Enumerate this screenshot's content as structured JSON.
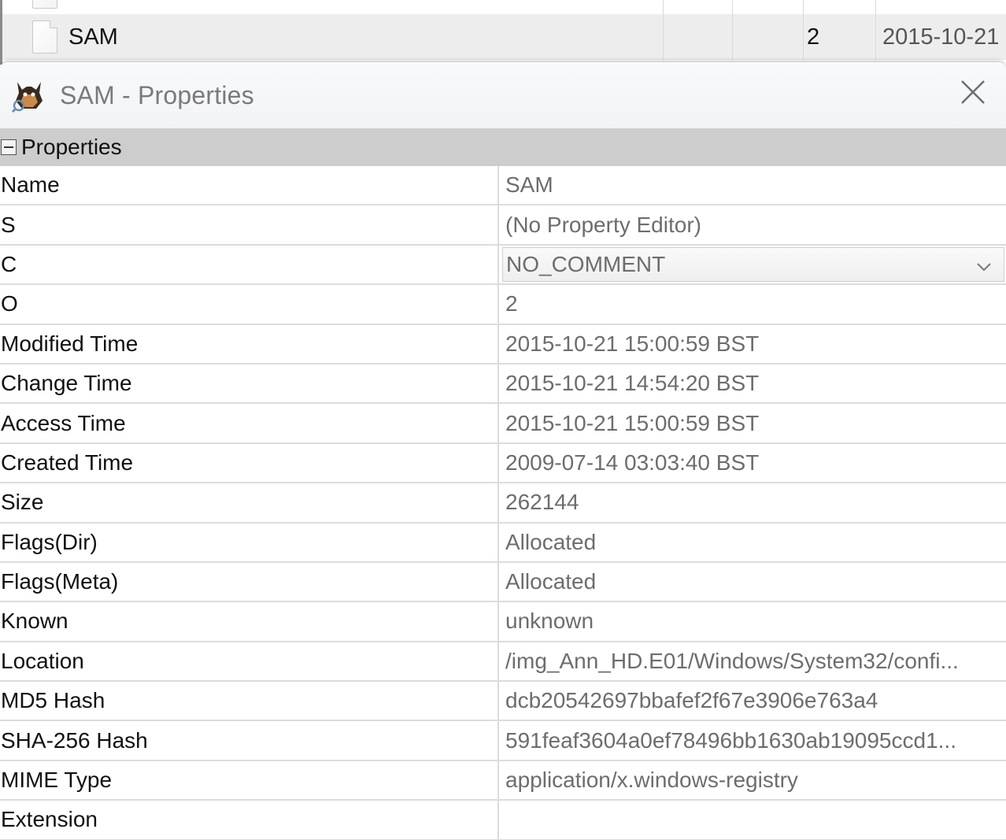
{
  "background_table": {
    "selected_row": {
      "name": "SAM",
      "col3": "2",
      "date": "2015-10-21"
    }
  },
  "dialog": {
    "title": "SAM - Properties",
    "section_label": "Properties",
    "properties": [
      {
        "key": "Name",
        "value": "SAM"
      },
      {
        "key": "S",
        "value": "(No Property Editor)"
      },
      {
        "key": "C",
        "value": "NO_COMMENT",
        "editor": "dropdown"
      },
      {
        "key": "O",
        "value": "2"
      },
      {
        "key": "Modified Time",
        "value": "2015-10-21 15:00:59 BST"
      },
      {
        "key": "Change Time",
        "value": "2015-10-21 14:54:20 BST"
      },
      {
        "key": "Access Time",
        "value": "2015-10-21 15:00:59 BST"
      },
      {
        "key": "Created Time",
        "value": "2009-07-14 03:03:40 BST"
      },
      {
        "key": "Size",
        "value": "262144"
      },
      {
        "key": "Flags(Dir)",
        "value": "Allocated"
      },
      {
        "key": "Flags(Meta)",
        "value": "Allocated"
      },
      {
        "key": "Known",
        "value": "unknown"
      },
      {
        "key": "Location",
        "value": "/img_Ann_HD.E01/Windows/System32/confi..."
      },
      {
        "key": "MD5 Hash",
        "value": "dcb20542697bbafef2f67e3906e763a4"
      },
      {
        "key": "SHA-256 Hash",
        "value": "591feaf3604a0ef78496bb1630ab19095ccd1..."
      },
      {
        "key": "MIME Type",
        "value": "application/x.windows-registry"
      },
      {
        "key": "Extension",
        "value": ""
      }
    ]
  },
  "icons": {
    "app": "autopsy-dog-icon",
    "close": "close-icon",
    "collapse": "collapse-minus-icon",
    "file": "file-icon",
    "dropdown": "chevron-down-icon"
  }
}
